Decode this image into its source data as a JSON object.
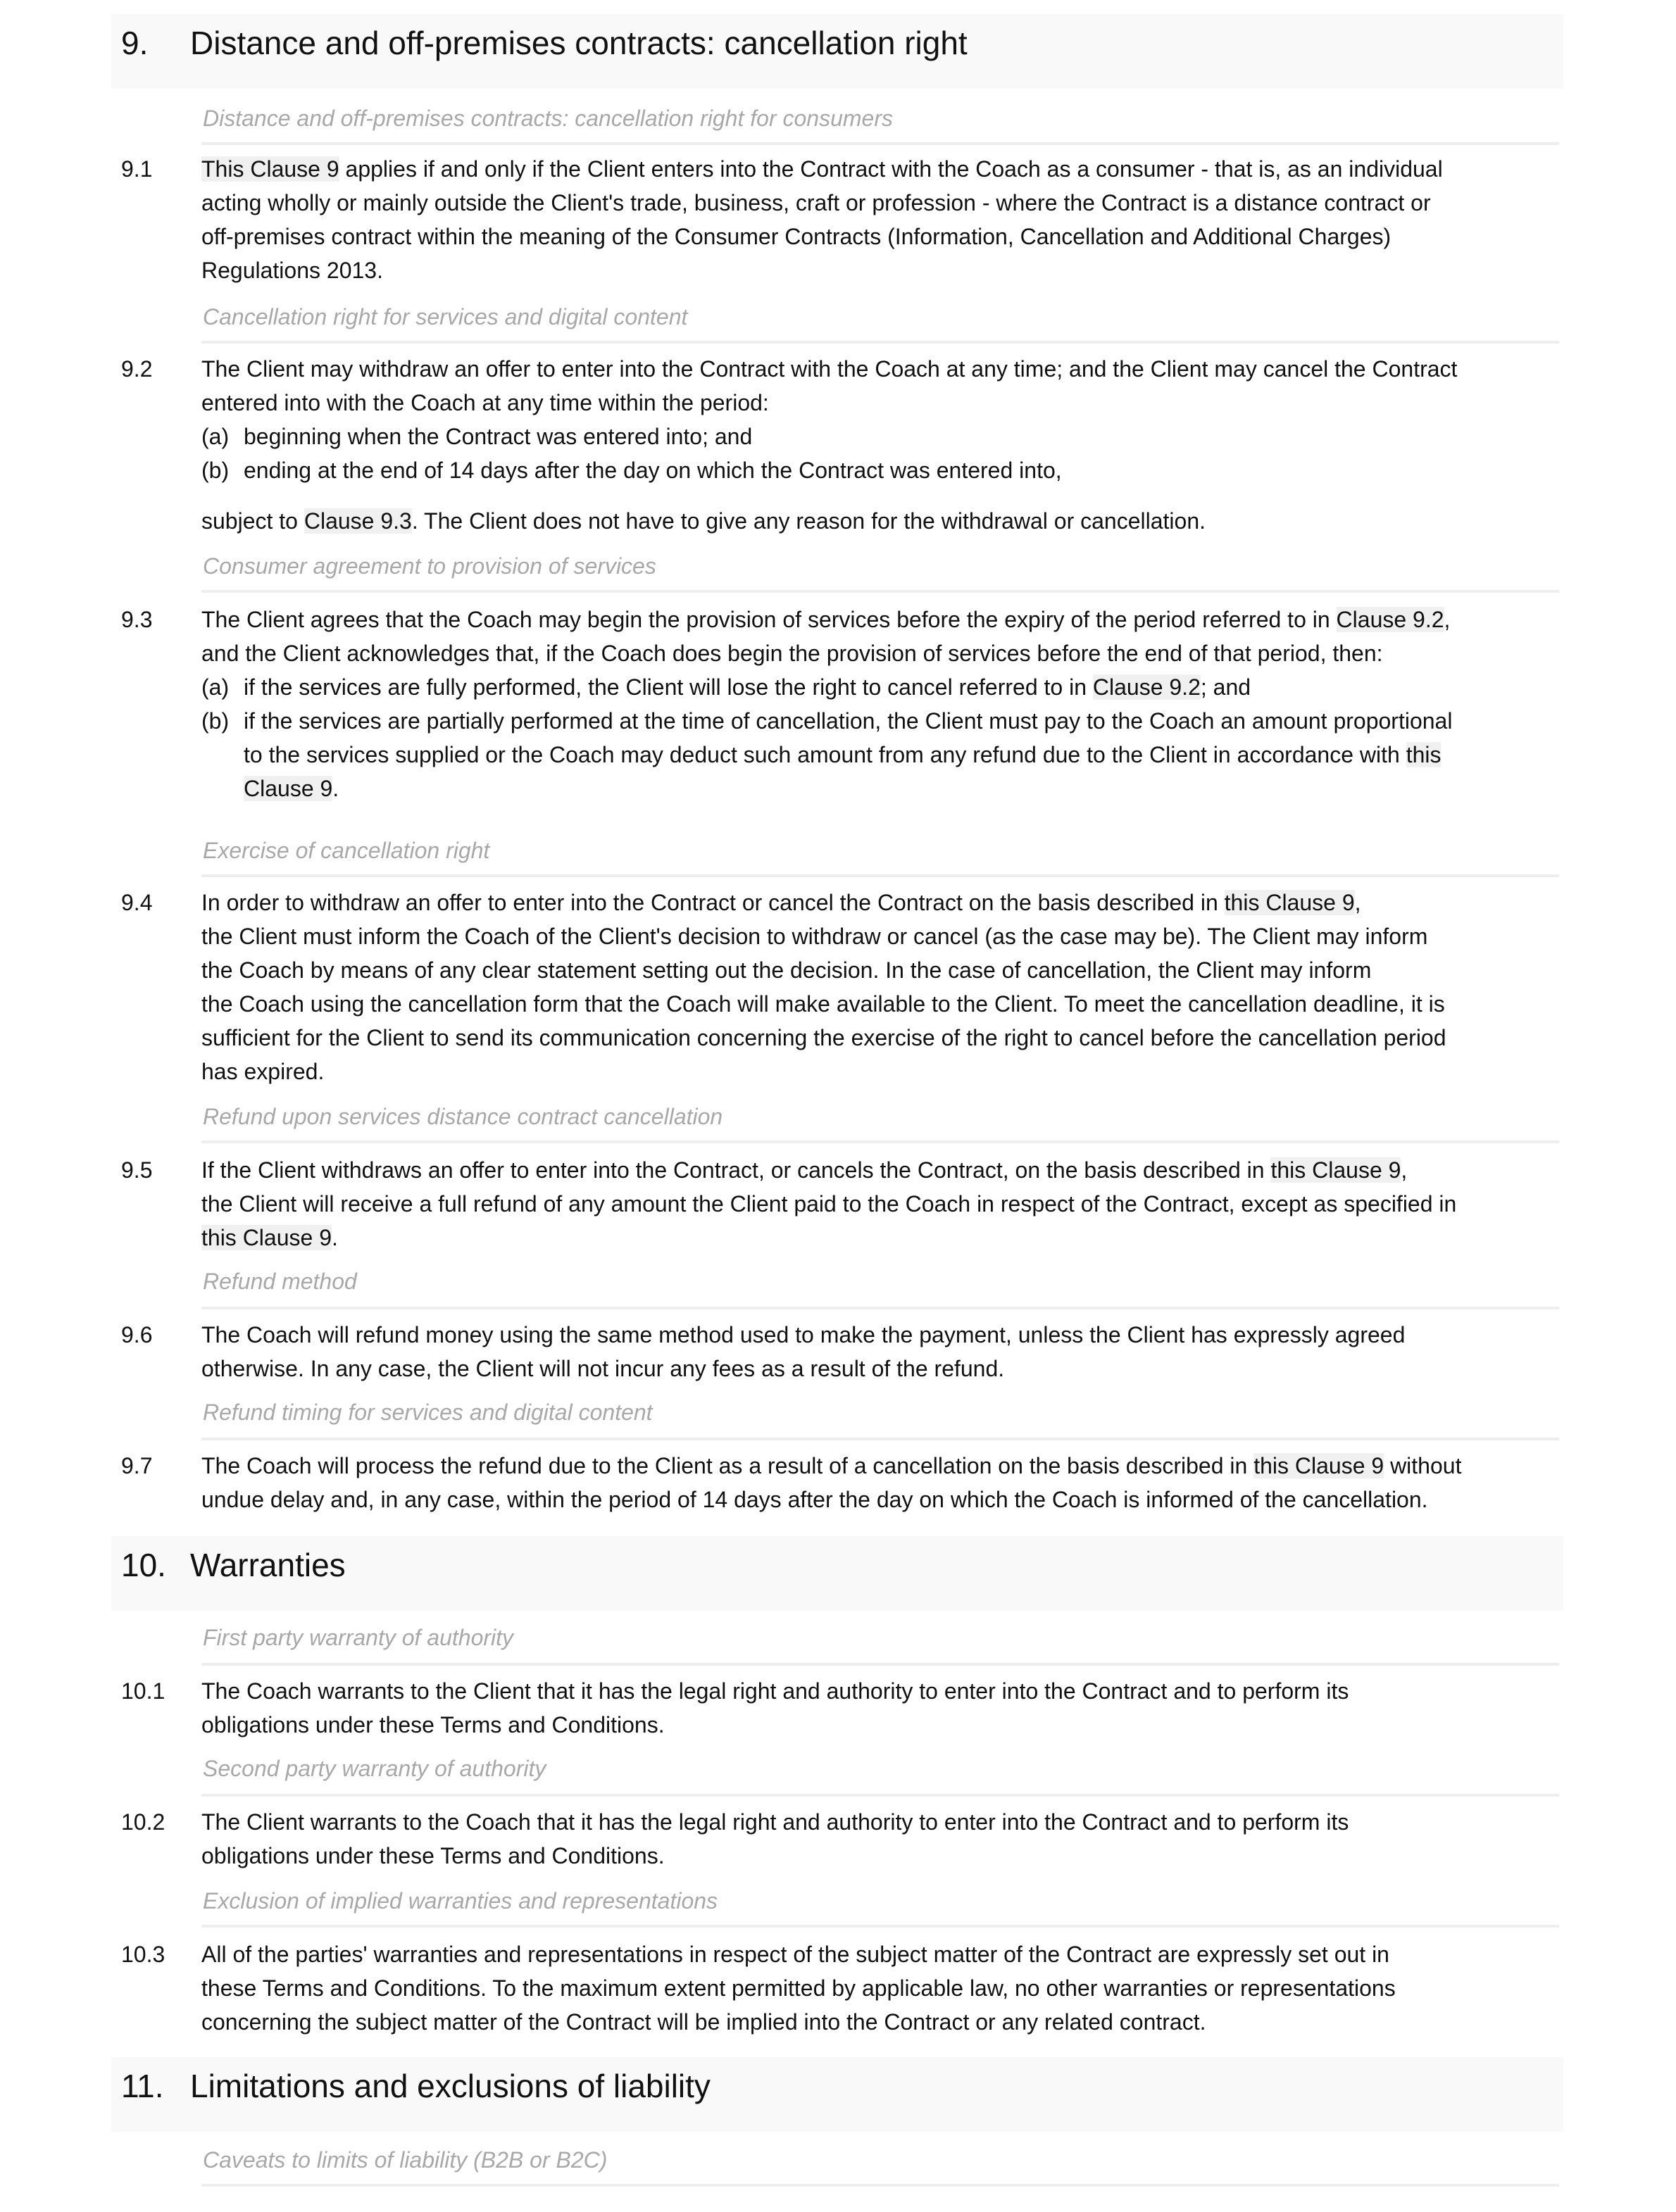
{
  "sections": [
    {
      "number": "9.",
      "title": "Distance and off-premises contracts: cancellation right",
      "clauses": [
        {
          "subheading": "Distance and off-premises contracts: cancellation right for consumers",
          "number": "9.1",
          "ref1": "This Clause 9",
          "line1_rest": " applies if and only if the Client enters into the Contract with the Coach as a consumer - that is, as an individual",
          "line2": "acting wholly or mainly outside the Client's trade, business, craft or profession - where the Contract is a distance contract or",
          "line3": "off-premises contract within the meaning of the Consumer Contracts (Information, Cancellation and Additional Charges)",
          "line4": "Regulations 2013."
        },
        {
          "subheading": "Cancellation right for services and digital content",
          "number": "9.2",
          "line1": "The Client may withdraw an offer to enter into the Contract with the Coach at any time; and the Client may cancel the Contract",
          "line2": "entered into with the Coach at any time within the period:",
          "item_a_label": "(a)",
          "item_a": "beginning when the Contract was entered into; and",
          "item_b_label": "(b)",
          "item_b": "ending at the end of 14 days after the day on which the Contract was entered into,",
          "tail_pre": "subject to ",
          "tail_ref": "Clause 9.3",
          "tail_post": ". The Client does not have to give any reason for the withdrawal or cancellation."
        },
        {
          "subheading": "Consumer agreement to provision of services",
          "number": "9.3",
          "line1_pre": "The Client agrees that the Coach may begin the provision of services before the expiry of the period referred to in ",
          "line1_ref": "Clause 9.2",
          "line1_post": ",",
          "line2": "and the Client acknowledges that, if the Coach does begin the provision of services before the end of that period, then:",
          "item_a_label": "(a)",
          "item_a_pre": "if the services are fully performed, the Client will lose the right to cancel referred to in ",
          "item_a_ref": "Clause 9.2",
          "item_a_post": "; and",
          "item_b_label": "(b)",
          "item_b_line1": "if the services are partially performed at the time of cancellation, the Client must pay to the Coach an amount proportional",
          "item_b_line2_pre": "to the services supplied or the Coach may deduct such amount from any refund due to the Client in accordance with ",
          "item_b_line2_ref": "this",
          "item_b_line3_ref": "Clause 9",
          "item_b_line3_post": "."
        },
        {
          "subheading": "Exercise of cancellation right",
          "number": "9.4",
          "line1_pre": "In order to withdraw an offer to enter into the Contract or cancel the Contract on the basis described in ",
          "line1_ref": "this Clause 9",
          "line1_post": ",",
          "line2": "the Client must inform the Coach of the Client's decision to withdraw or cancel (as the case may be). The Client may inform",
          "line3": "the Coach by means of any clear statement setting out the decision. In the case of cancellation, the Client may inform",
          "line4": "the Coach using the cancellation form that the Coach will make available to the Client. To meet the cancellation deadline, it is",
          "line5": "sufficient for the Client to send its communication concerning the exercise of the right to cancel before the cancellation period",
          "line6": "has expired."
        },
        {
          "subheading": "Refund upon services distance contract cancellation",
          "number": "9.5",
          "line1_pre": "If the Client withdraws an offer to enter into the Contract, or cancels the Contract, on the basis described in ",
          "line1_ref": "this Clause 9",
          "line1_post": ",",
          "line2": "the Client will receive a full refund of any amount the Client paid to the Coach in respect of the Contract, except as specified in",
          "line3_ref": "this Clause 9",
          "line3_post": "."
        },
        {
          "subheading": "Refund method",
          "number": "9.6",
          "line1": "The Coach will refund money using the same method used to make the payment, unless the Client has expressly agreed",
          "line2": "otherwise. In any case, the Client will not incur any fees as a result of the refund."
        },
        {
          "subheading": "Refund timing for services and digital content",
          "number": "9.7",
          "line1_pre": "The Coach will process the refund due to the Client as a result of a cancellation on the basis described in ",
          "line1_ref": "this Clause 9",
          "line1_post": " without",
          "line2": "undue delay and, in any case, within the period of 14 days after the day on which the Coach is informed of the cancellation."
        }
      ]
    },
    {
      "number": "10.",
      "title": "Warranties",
      "clauses": [
        {
          "subheading": "First party warranty of authority",
          "number": "10.1",
          "line1": "The Coach warrants to the Client that it has the legal right and authority to enter into the Contract and to perform its",
          "line2": "obligations under these Terms and Conditions."
        },
        {
          "subheading": "Second party warranty of authority",
          "number": "10.2",
          "line1": "The Client warrants to the Coach that it has the legal right and authority to enter into the Contract and to perform its",
          "line2": "obligations under these Terms and Conditions."
        },
        {
          "subheading": "Exclusion of implied warranties and representations",
          "number": "10.3",
          "line1": "All of the parties' warranties and representations in respect of the subject matter of the Contract are expressly set out in",
          "line2": "these Terms and Conditions. To the maximum extent permitted by applicable law, no other warranties or representations",
          "line3": "concerning the subject matter of the Contract will be implied into the Contract or any related contract."
        }
      ]
    },
    {
      "number": "11.",
      "title": "Limitations and exclusions of liability",
      "clauses": [
        {
          "subheading": "Caveats to limits of liability (B2B or B2C)"
        }
      ]
    }
  ]
}
